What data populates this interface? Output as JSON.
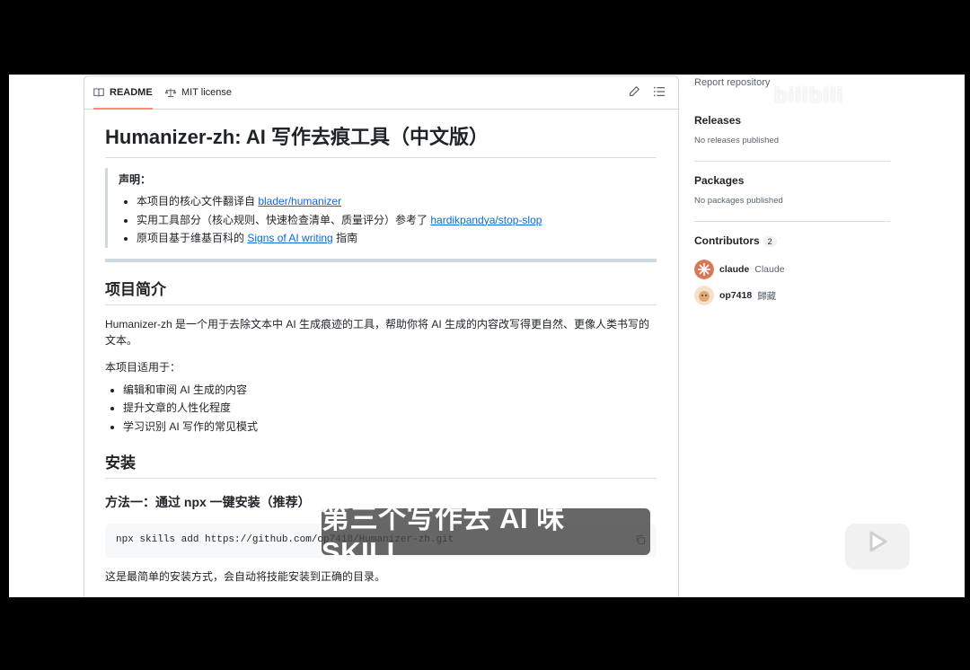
{
  "tabs": {
    "readme": "README",
    "license": "MIT license"
  },
  "readme": {
    "title": "Humanizer-zh: AI 写作去痕工具（中文版）",
    "notice": {
      "title": "声明：",
      "items": [
        {
          "prefix": "本项目的核心文件翻译自 ",
          "link": "blader/humanizer",
          "suffix": ""
        },
        {
          "prefix": "实用工具部分（核心规则、快速检查清单、质量评分）参考了 ",
          "link": "hardikpandya/stop-slop",
          "suffix": ""
        },
        {
          "prefix": "原项目基于维基百科的 ",
          "link": "Signs of AI writing",
          "suffix": " 指南"
        }
      ]
    },
    "intro_heading": "项目简介",
    "intro_text": "Humanizer-zh 是一个用于去除文本中 AI 生成痕迹的工具，帮助你将 AI 生成的内容改写得更自然、更像人类书写的文本。",
    "usage_label": "本项目适用于：",
    "usage_items": [
      "编辑和审阅 AI 生成的内容",
      "提升文章的人性化程度",
      "学习识别 AI 写作的常见模式"
    ],
    "install_heading": "安装",
    "method1_heading": "方法一：通过 npx 一键安装（推荐）",
    "command": "npx skills add https://github.com/op7418/Humanizer-zh.git",
    "after_text": "这是最简单的安装方式，会自动将技能安装到正确的目录。"
  },
  "sidebar": {
    "report": "Report repository",
    "releases_title": "Releases",
    "releases_meta": "No releases published",
    "packages_title": "Packages",
    "packages_meta": "No packages published",
    "contributors_title": "Contributors",
    "contributors_count": "2",
    "contributors": [
      {
        "login": "claude",
        "name": "Claude",
        "color": "#d97757"
      },
      {
        "login": "op7418",
        "name": "歸藏",
        "color": "#e9c9a8"
      }
    ]
  },
  "overlay": {
    "watermark": "bilibili",
    "subtitle": "第三个写作去 AI 味 SKILL"
  },
  "icons": {
    "readme_tab": "book-icon",
    "license_tab": "scale-icon",
    "edit": "pencil-icon",
    "outline": "list-icon",
    "copy": "copy-icon",
    "player": "bilibili-tv-icon"
  }
}
